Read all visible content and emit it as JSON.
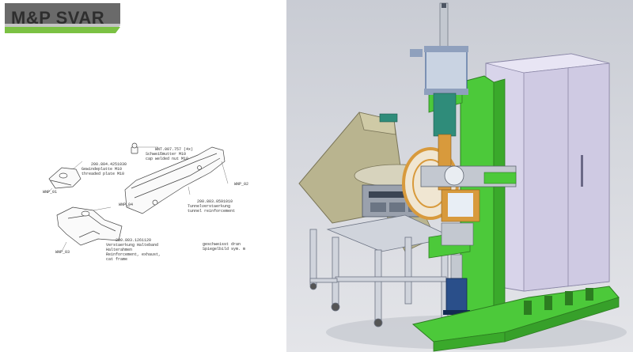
{
  "brand": {
    "logo_text": "M&P SVAR",
    "colors": {
      "green": "#7bc143",
      "gray": "#5a5a5a"
    }
  },
  "drawing": {
    "part_labels": [
      {
        "number": "200.804.4251030",
        "desc": "Gewindeplatte M10\nthreaded plate M10"
      },
      {
        "number": "WNT.007.757 (4x)",
        "desc": "Schweißmutter M10\ncap welded nut M10"
      },
      {
        "number": "200.803.0591010",
        "desc": "Tunnelverstaerkung\ntunnel reinforcement"
      },
      {
        "number": "200.803.1261120",
        "desc": "Verstaerkung Halteband\nHalterahmen\nReinforcement, exhaust,\ncat frame"
      }
    ],
    "note": "geschweisst dran\nSpiegelbild sym. m",
    "view_tags": [
      "WNP_01",
      "WNP_02",
      "WNP_03",
      "WNP_04"
    ]
  },
  "machine": {
    "colors": {
      "frame_green": "#4cc93a",
      "cabinet": "#d8d4ea",
      "bowl": "#b9b48f",
      "steel": "#c3c8d0",
      "copper": "#d89a3c",
      "blue_cylinder": "#2a4f8a"
    }
  }
}
